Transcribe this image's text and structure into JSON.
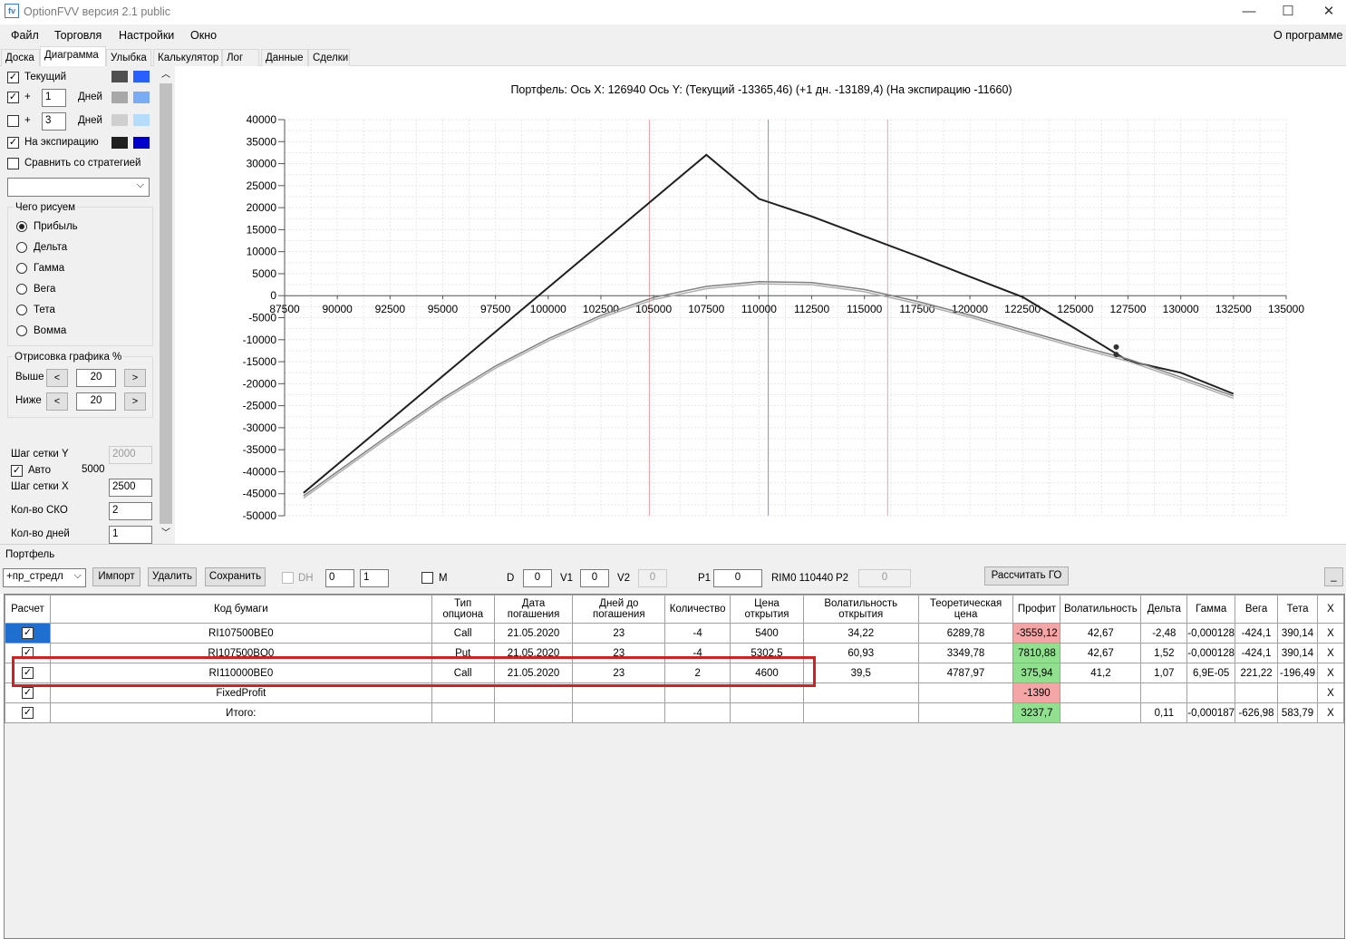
{
  "window": {
    "title": "OptionFVV версия 2.1 public",
    "minimize": "—",
    "maximize": "☐",
    "close": "✕"
  },
  "menu": {
    "items": [
      "Файл",
      "Торговля",
      "Настройки",
      "Окно"
    ],
    "about": "О программе"
  },
  "tabs": [
    "Доска",
    "Диаграмма",
    "Улыбка",
    "Калькулятор",
    "Лог",
    "Данные",
    "Сделки"
  ],
  "left": {
    "current_label": "Текущий",
    "plus_label": "+",
    "days_label": "Дней",
    "day1_value": "1",
    "day3_value": "3",
    "expiry_label": "На экспирацию",
    "compare_label": "Сравнить со стратегией",
    "draw_group": "Чего рисуем",
    "radios": [
      "Прибыль",
      "Дельта",
      "Гамма",
      "Вега",
      "Тета",
      "Вомма"
    ],
    "render_group": "Отрисовка графика %",
    "above_label": "Выше",
    "below_label": "Ниже",
    "above_value": "20",
    "below_value": "20",
    "dec": "<",
    "inc": ">",
    "grid_y_label": "Шаг сетки Y",
    "grid_y_value": "2000",
    "auto_label": "Авто",
    "auto_value": "5000",
    "grid_x_label": "Шаг сетки X",
    "grid_x_value": "2500",
    "sko_label": "Кол-во СКО",
    "sko_value": "2",
    "days_count_label": "Кол-во дней",
    "days_count_value": "1",
    "colors": {
      "current": [
        "#505050",
        "#2a5fff"
      ],
      "d1": [
        "#a8a8a8",
        "#7aacf5"
      ],
      "d3": [
        "#cfcfcf",
        "#b5dcfa"
      ],
      "expiry": [
        "#202020",
        "#0000cc"
      ]
    }
  },
  "chart_data": {
    "type": "line",
    "title": "Портфель: Ось X: 126940 Ось Y:  (Текущий -13365,46)  (+1 дн. -13189,4)  (На экспирацию -11660)",
    "xlim": [
      87500,
      135000
    ],
    "ylim": [
      -50000,
      40000
    ],
    "xticks": [
      87500,
      90000,
      92500,
      95000,
      97500,
      100000,
      102500,
      105000,
      107500,
      110000,
      112500,
      115000,
      117500,
      120000,
      122500,
      125000,
      127500,
      130000,
      132500,
      135000
    ],
    "xtick_labels": [
      "87500",
      "90000",
      "92500",
      "95000",
      "97500",
      "100000",
      "102500",
      "105000",
      "107500",
      "110000",
      "112500",
      "115000",
      "117500",
      "120000",
      "122500",
      "125000",
      "127500",
      "130000",
      "132500",
      "135000"
    ],
    "yticks": [
      40000,
      35000,
      30000,
      25000,
      20000,
      15000,
      10000,
      5000,
      0,
      -5000,
      -10000,
      -15000,
      -20000,
      -25000,
      -30000,
      -35000,
      -40000,
      -45000,
      -50000
    ],
    "ytick_labels": [
      "40000",
      "35000",
      "30000",
      "25000",
      "20000",
      "15000",
      "10000",
      "5000",
      "0",
      "-5000",
      "-10000",
      "-15000",
      "-20000",
      "-25000",
      "-30000",
      "-35000",
      "-40000",
      "-45000",
      "-50000"
    ],
    "vlines": [
      {
        "x": 104800,
        "color": "#f0a0a8"
      },
      {
        "x": 110440,
        "color": "#8090a8"
      },
      {
        "x": 116100,
        "color": "#f0a0a8"
      }
    ],
    "series": [
      {
        "color": "#202020",
        "points": [
          [
            88400,
            -44800
          ],
          [
            107500,
            32000
          ],
          [
            110000,
            22000
          ],
          [
            112500,
            18000
          ],
          [
            115000,
            13500
          ],
          [
            117500,
            9000
          ],
          [
            120000,
            4300
          ],
          [
            122500,
            -300
          ],
          [
            125000,
            -7500
          ],
          [
            127500,
            -14800
          ],
          [
            130000,
            -17500
          ],
          [
            132500,
            -22300
          ]
        ]
      },
      {
        "color": "#808080",
        "points": [
          [
            88400,
            -45500
          ],
          [
            90000,
            -40000
          ],
          [
            92500,
            -31500
          ],
          [
            95000,
            -23300
          ],
          [
            97500,
            -16000
          ],
          [
            100000,
            -9800
          ],
          [
            102500,
            -4500
          ],
          [
            105000,
            -400
          ],
          [
            107500,
            2100
          ],
          [
            110000,
            3200
          ],
          [
            112500,
            3000
          ],
          [
            115000,
            1400
          ],
          [
            117500,
            -1300
          ],
          [
            120000,
            -4400
          ],
          [
            122500,
            -7800
          ],
          [
            125000,
            -11200
          ],
          [
            127500,
            -14400
          ],
          [
            130000,
            -18500
          ],
          [
            132500,
            -22800
          ]
        ]
      },
      {
        "color": "#b0b0b0",
        "points": [
          [
            88400,
            -46000
          ],
          [
            90000,
            -40500
          ],
          [
            92500,
            -32000
          ],
          [
            95000,
            -23800
          ],
          [
            97500,
            -16500
          ],
          [
            100000,
            -10300
          ],
          [
            102500,
            -5000
          ],
          [
            105000,
            -900
          ],
          [
            107500,
            1600
          ],
          [
            110000,
            2700
          ],
          [
            112500,
            2500
          ],
          [
            115000,
            900
          ],
          [
            117500,
            -1800
          ],
          [
            120000,
            -4900
          ],
          [
            122500,
            -8300
          ],
          [
            125000,
            -11700
          ],
          [
            127500,
            -14900
          ],
          [
            130000,
            -19000
          ],
          [
            132500,
            -23300
          ]
        ]
      }
    ],
    "markers": [
      {
        "x": 126940,
        "y": -11660
      },
      {
        "x": 126940,
        "y": -13365
      }
    ]
  },
  "portfolio": {
    "section_label": "Портфель",
    "strategy_value": "+пр_стредл",
    "import_label": "Импорт",
    "delete_label": "Удалить",
    "save_label": "Сохранить",
    "dh_label": "DH",
    "dh_a": "0",
    "dh_b": "1",
    "m_label": "M",
    "d_label": "D",
    "d_value": "0",
    "v1_label": "V1",
    "v1_value": "0",
    "v2_label": "V2",
    "v2_value": "0",
    "p1_label": "P1",
    "p1_value": "0",
    "rim_label": "RIM0 110440",
    "p2_label": "P2",
    "p2_value": "0",
    "calc_go_label": "Рассчитать ГО",
    "min_label": "_"
  },
  "table": {
    "headers": [
      "Расчет",
      "Код бумаги",
      "Тип\nопциона",
      "Дата\nпогашения",
      "Дней до\nпогашения",
      "Количество",
      "Цена\nоткрытия",
      "Волатильность\nоткрытия",
      "Теоретическая\nцена",
      "Профит",
      "Волатильность",
      "Дельта",
      "Гамма",
      "Вега",
      "Тета",
      "X"
    ],
    "rows": [
      {
        "code": "RI107500BE0",
        "type": "Call",
        "date": "21.05.2020",
        "days": "23",
        "qty": "-4",
        "price": "5400",
        "vol_open": "34,22",
        "theo": "6289,78",
        "profit": "-3559,12",
        "vol": "42,67",
        "delta": "-2,48",
        "gamma": "-0,000128",
        "vega": "-424,1",
        "theta": "390,14",
        "x": "X",
        "profit_state": "neg",
        "sel": true
      },
      {
        "code": "RI107500BQ0",
        "type": "Put",
        "date": "21.05.2020",
        "days": "23",
        "qty": "-4",
        "price": "5302,5",
        "vol_open": "60,93",
        "theo": "3349,78",
        "profit": "7810,88",
        "vol": "42,67",
        "delta": "1,52",
        "gamma": "-0,000128",
        "vega": "-424,1",
        "theta": "390,14",
        "x": "X",
        "profit_state": "pos",
        "sel": false
      },
      {
        "code": "RI110000BE0",
        "type": "Call",
        "date": "21.05.2020",
        "days": "23",
        "qty": "2",
        "price": "4600",
        "vol_open": "39,5",
        "theo": "4787,97",
        "profit": "375,94",
        "vol": "41,2",
        "delta": "1,07",
        "gamma": "6,9E-05",
        "vega": "221,22",
        "theta": "-196,49",
        "x": "X",
        "profit_state": "pos",
        "sel": false
      },
      {
        "code": "FixedProfit",
        "type": "",
        "date": "",
        "days": "",
        "qty": "",
        "price": "",
        "vol_open": "",
        "theo": "",
        "profit": "-1390",
        "vol": "",
        "delta": "",
        "gamma": "",
        "vega": "",
        "theta": "",
        "x": "X",
        "profit_state": "neg",
        "sel": false
      },
      {
        "code": "Итого:",
        "type": "",
        "date": "",
        "days": "",
        "qty": "",
        "price": "",
        "vol_open": "",
        "theo": "",
        "profit": "3237,7",
        "vol": "",
        "delta": "0,11",
        "gamma": "-0,000187",
        "vega": "-626,98",
        "theta": "583,79",
        "x": "X",
        "profit_state": "pos",
        "sel": false
      }
    ]
  }
}
